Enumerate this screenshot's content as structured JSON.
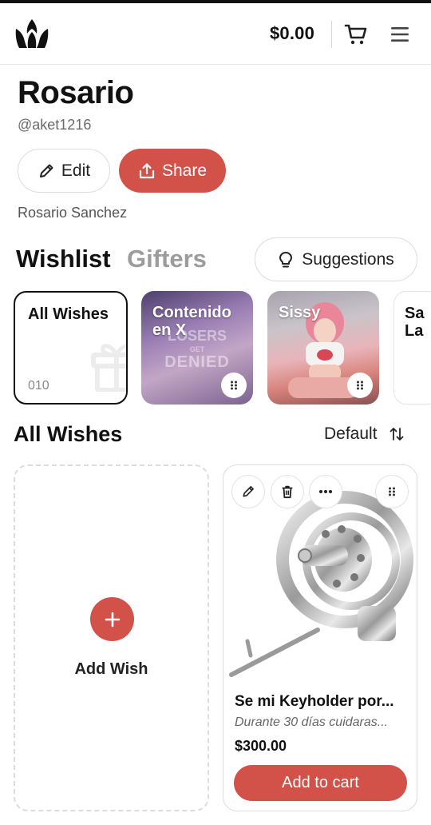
{
  "header": {
    "logo_icon": "crown-leaf-logo",
    "balance": "$0.00",
    "cart_icon": "cart-icon",
    "menu_icon": "hamburger-menu-icon"
  },
  "profile": {
    "name": "Rosario",
    "handle": "@aket1216",
    "edit_label": "Edit",
    "share_label": "Share",
    "full_name": "Rosario Sanchez"
  },
  "tabs": {
    "wishlist": "Wishlist",
    "gifters": "Gifters",
    "suggestions_label": "Suggestions"
  },
  "categories": [
    {
      "label": "All Wishes",
      "count": "010"
    },
    {
      "label": "Contenido en X",
      "overlay_text": [
        "LOSERS",
        "GET",
        "DENIED"
      ]
    },
    {
      "label": "Sissy"
    },
    {
      "label": "Sa La"
    }
  ],
  "section": {
    "title": "All Wishes",
    "sort_label": "Default"
  },
  "add_card": {
    "label": "Add Wish"
  },
  "product": {
    "title": "Se mi Keyholder por...",
    "description": "Durante 30 días cuidaras...",
    "price": "$300.00",
    "cart_button": "Add to cart"
  },
  "colors": {
    "accent": "#d2524a",
    "text": "#111111",
    "muted": "#9c9c9c"
  }
}
